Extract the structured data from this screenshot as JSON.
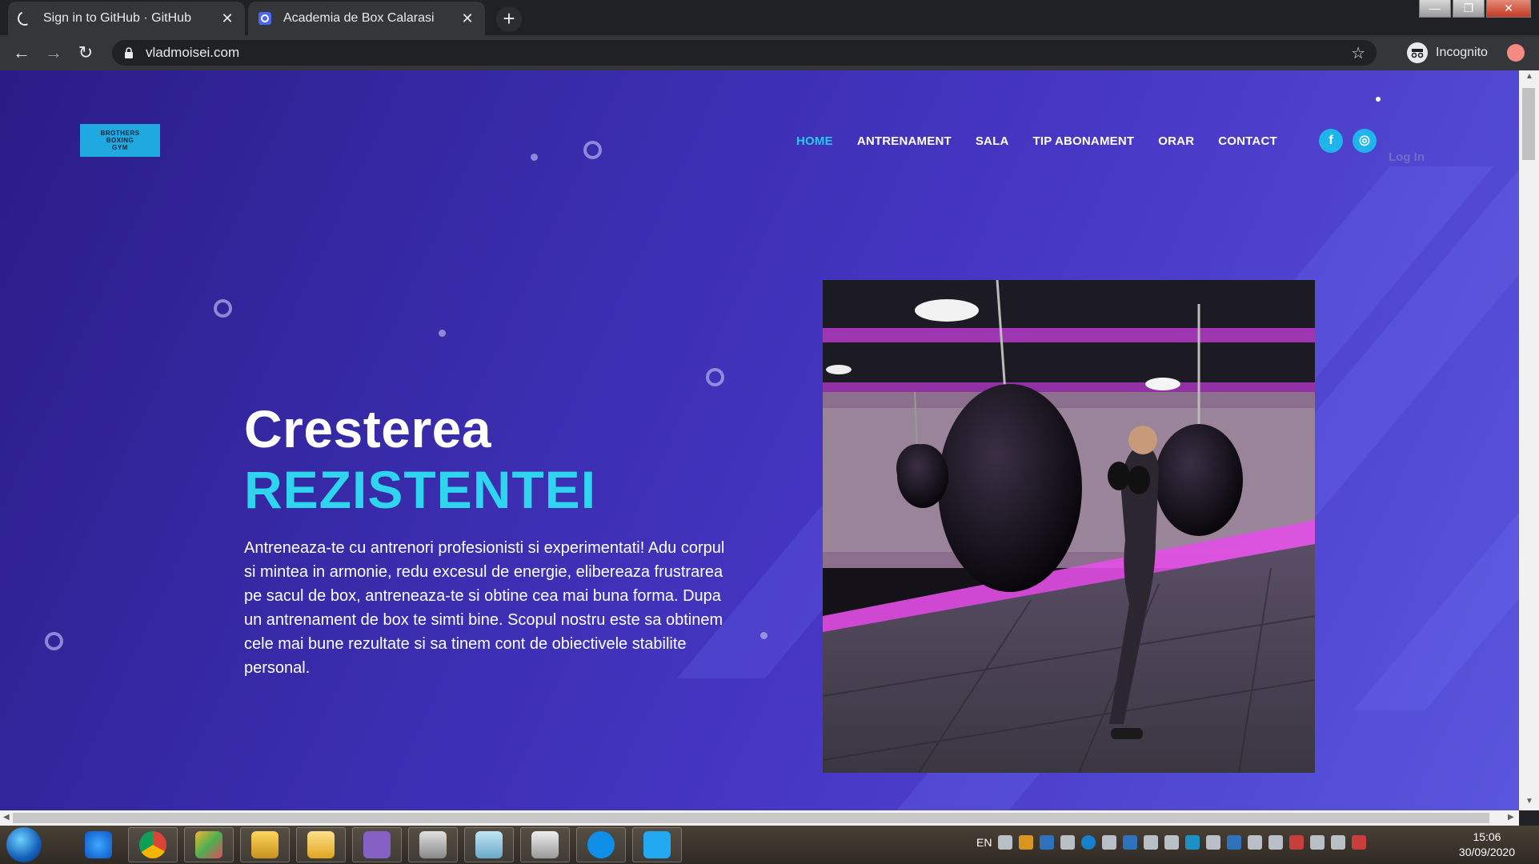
{
  "browser": {
    "tabs": [
      {
        "title": "Sign in to GitHub · GitHub",
        "state": "loading"
      },
      {
        "title": "Academia de Box Calarasi",
        "state": "active"
      }
    ],
    "new_tab_label": "+",
    "close_label": "✕",
    "url": "vladmoisei.com",
    "profile_label": "Incognito",
    "window_controls": {
      "minimize": "—",
      "maximize": "❐",
      "close": "✕"
    }
  },
  "page": {
    "logo_lines": [
      "BROTHERS",
      "BOXING",
      "GYM"
    ],
    "nav": [
      "HOME",
      "ANTRENAMENT",
      "SALA",
      "TIP ABONAMENT",
      "ORAR",
      "CONTACT"
    ],
    "active_nav": "HOME",
    "social": [
      {
        "name": "facebook",
        "glyph": "f"
      },
      {
        "name": "instagram",
        "glyph": "◎"
      }
    ],
    "login_label": "Log In",
    "hero": {
      "title_line1": "Cresterea",
      "title_line2": "REZISTENTEI",
      "intro": "Antreneaza-te cu antrenori profesionisti si experimentati! Adu corpul si mintea in armonie, redu excesul de energie, elibereaza frustrarea pe sacul de box, antreneaza-te si obtine cea mai buna forma. Dupa un antrenament de box te simti bine. Scopul nostru este sa obtinem cele mai bune rezultate si sa tinem cont de obiectivele stabilite personal."
    },
    "colors": {
      "accent": "#2fd4ef",
      "nav_active": "#28c7f0",
      "social": "#1fb4ea",
      "bg_dark": "#2a1c86",
      "bg_light": "#5a56dc"
    }
  },
  "taskbar": {
    "apps": [
      "internet-explorer",
      "chrome",
      "git-gui",
      "database-tool",
      "file-explorer",
      "visual-studio",
      "paint-tool",
      "notepad-tool",
      "snipping-tool",
      "teamviewer",
      "vscode"
    ],
    "language": "EN",
    "time": "15:06",
    "date": "30/09/2020"
  }
}
